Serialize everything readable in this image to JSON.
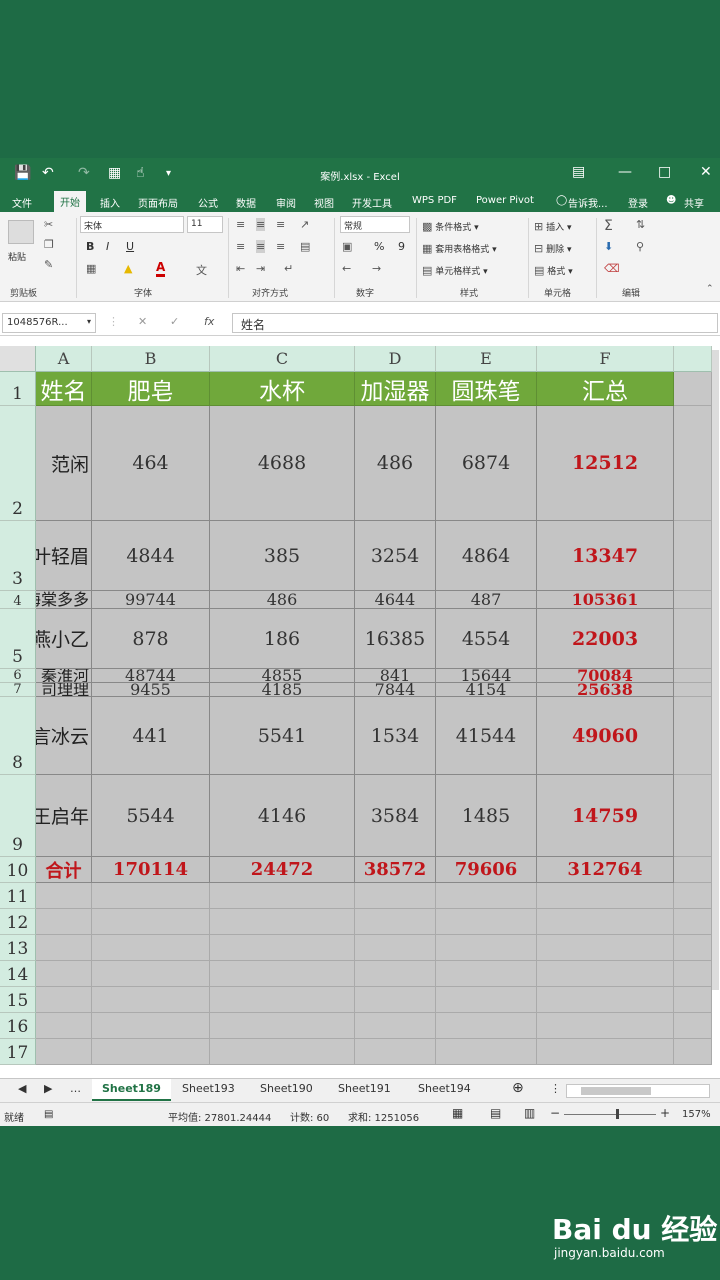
{
  "app": {
    "title": "案例.xlsx - Excel",
    "quick_access": [
      "save-icon",
      "undo-icon",
      "redo-icon",
      "table-icon",
      "touch-mode-icon",
      "customize-icon"
    ]
  },
  "tabs": [
    "文件",
    "开始",
    "插入",
    "页面布局",
    "公式",
    "数据",
    "审阅",
    "视图",
    "开发工具",
    "WPS PDF",
    "Power Pivot",
    "告诉我...",
    "登录",
    "共享"
  ],
  "active_tab": "开始",
  "ribbon": {
    "paste_label": "粘贴",
    "font_name": "宋体",
    "font_size": "11",
    "bold": "B",
    "italic": "I",
    "underline": "U",
    "font_color_glyph": "A",
    "number_format": "常规",
    "percent": "%",
    "comma": "9",
    "cond_format": "条件格式",
    "table_format": "套用表格格式",
    "cell_style": "单元格样式",
    "insert": "插入",
    "delete": "删除",
    "format": "格式",
    "groups": [
      "剪贴板",
      "字体",
      "对齐方式",
      "数字",
      "样式",
      "单元格",
      "编辑"
    ]
  },
  "formula_bar": {
    "name_box": "1048576R...",
    "fx": "fx",
    "content": "姓名"
  },
  "columns": [
    "A",
    "B",
    "C",
    "D",
    "E",
    "F"
  ],
  "header_row": [
    "姓名",
    "肥皂",
    "水杯",
    "加湿器",
    "圆珠笔",
    "汇总"
  ],
  "data_rows": [
    {
      "row": "2",
      "name": "范闲",
      "values": [
        "464",
        "4688",
        "486",
        "6874"
      ],
      "total": "12512"
    },
    {
      "row": "3",
      "name": "叶轻眉",
      "values": [
        "4844",
        "385",
        "3254",
        "4864"
      ],
      "total": "13347"
    },
    {
      "row": "4",
      "name": "海棠多多",
      "values": [
        "99744",
        "486",
        "4644",
        "487"
      ],
      "total": "105361"
    },
    {
      "row": "5",
      "name": "燕小乙",
      "values": [
        "878",
        "186",
        "16385",
        "4554"
      ],
      "total": "22003"
    },
    {
      "row": "6",
      "name": "秦淮河",
      "values": [
        "48744",
        "4855",
        "841",
        "15644"
      ],
      "total": "70084"
    },
    {
      "row": "7",
      "name": "司理理",
      "values": [
        "9455",
        "4185",
        "7844",
        "4154"
      ],
      "total": "25638"
    },
    {
      "row": "8",
      "name": "言冰云",
      "values": [
        "441",
        "5541",
        "1534",
        "41544"
      ],
      "total": "49060"
    },
    {
      "row": "9",
      "name": "王启年",
      "values": [
        "5544",
        "4146",
        "3584",
        "1485"
      ],
      "total": "14759"
    }
  ],
  "sum_row": {
    "row": "10",
    "label": "合计",
    "values": [
      "170114",
      "24472",
      "38572",
      "79606",
      "312764"
    ]
  },
  "empty_rows": [
    "11",
    "12",
    "13",
    "14",
    "15",
    "16",
    "17"
  ],
  "sheets": [
    "Sheet189",
    "Sheet193",
    "Sheet190",
    "Sheet191",
    "Sheet194"
  ],
  "active_sheet": "Sheet189",
  "status": {
    "ready": "就绪",
    "average": "平均值: 27801.24444",
    "count": "计数: 60",
    "sum": "求和: 1251056",
    "zoom": "157%"
  },
  "watermark": {
    "logo": "Bai du 经验",
    "url": "jingyan.baidu.com"
  }
}
